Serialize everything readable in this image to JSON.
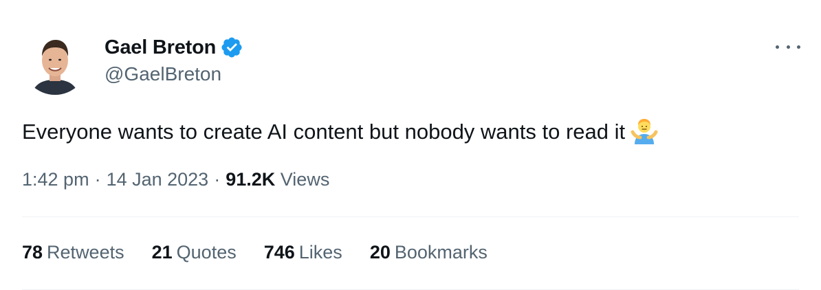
{
  "author": {
    "display_name": "Gael Breton",
    "handle": "@GaelBreton",
    "verified_icon": "verified-badge-icon",
    "verified_color": "#1d9bf0"
  },
  "tweet": {
    "text": "Everyone wants to create AI content but nobody wants to read it",
    "emoji_icon": "man-shrugging-emoji"
  },
  "meta": {
    "time": "1:42 pm",
    "separator": "·",
    "date": "14 Jan 2023",
    "views_count": "91.2K",
    "views_label": "Views"
  },
  "stats": {
    "retweets_count": "78",
    "retweets_label": "Retweets",
    "quotes_count": "21",
    "quotes_label": "Quotes",
    "likes_count": "746",
    "likes_label": "Likes",
    "bookmarks_count": "20",
    "bookmarks_label": "Bookmarks"
  },
  "colors": {
    "text_primary": "#0f1419",
    "text_secondary": "#536471",
    "divider": "#eff3f4"
  }
}
